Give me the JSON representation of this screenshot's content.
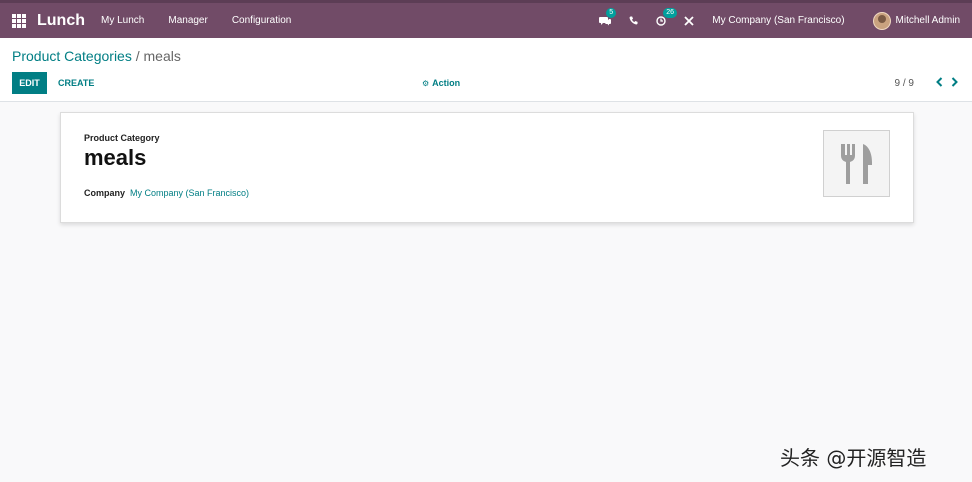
{
  "navbar": {
    "app_name": "Lunch",
    "menu": [
      "My Lunch",
      "Manager",
      "Configuration"
    ],
    "messages_badge": "5",
    "activities_badge": "26",
    "company": "My Company (San Francisco)",
    "user": "Mitchell Admin"
  },
  "breadcrumb": {
    "parent": "Product Categories",
    "separator": " / ",
    "current": "meals"
  },
  "toolbar": {
    "edit_label": "EDIT",
    "create_label": "CREATE",
    "action_label": "Action"
  },
  "pager": {
    "value": "9 / 9"
  },
  "form": {
    "title_label": "Product Category",
    "name": "meals",
    "company_label": "Company",
    "company_value": "My Company (San Francisco)"
  },
  "watermark": "头条 @开源智造",
  "colors": {
    "navbar": "#714b67",
    "accent": "#017e84"
  }
}
